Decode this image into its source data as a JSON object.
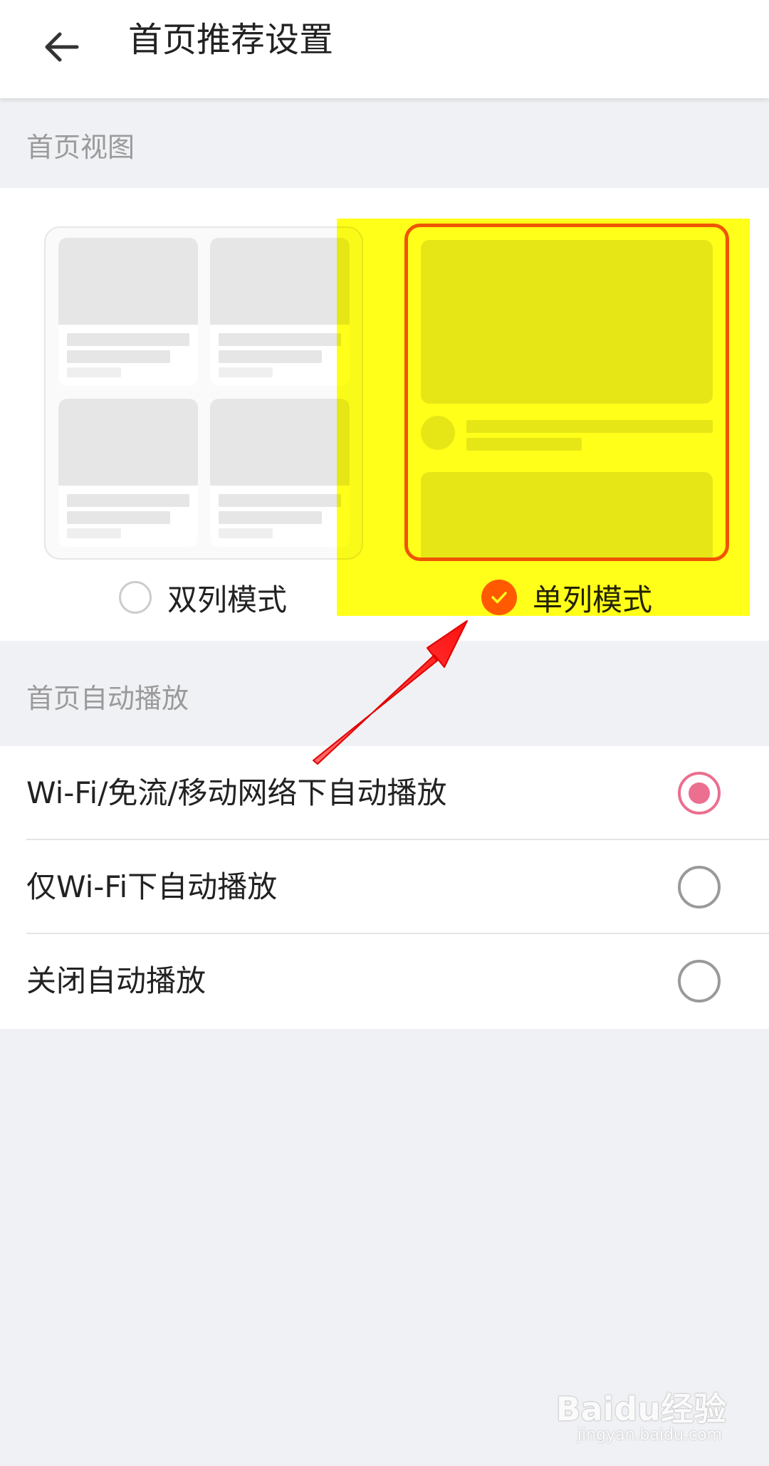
{
  "header": {
    "title": "首页推荐设置"
  },
  "sections": {
    "view_title": "首页视图",
    "autoplay_title": "首页自动播放"
  },
  "view_modes": [
    {
      "label": "双列模式",
      "selected": false
    },
    {
      "label": "单列模式",
      "selected": true
    }
  ],
  "autoplay_options": [
    {
      "label": "Wi-Fi/免流/移动网络下自动播放",
      "selected": true
    },
    {
      "label": "仅Wi-Fi下自动播放",
      "selected": false
    },
    {
      "label": "关闭自动播放",
      "selected": false
    }
  ],
  "watermark": {
    "brand": "Baidu经验",
    "domain": "jingyan.baidu.com"
  },
  "colors": {
    "accent_orange": "#ff5a0a",
    "accent_pink": "#eb6f8f",
    "annotation_highlight": "#ffff00",
    "annotation_arrow": "#ff1a1a"
  }
}
